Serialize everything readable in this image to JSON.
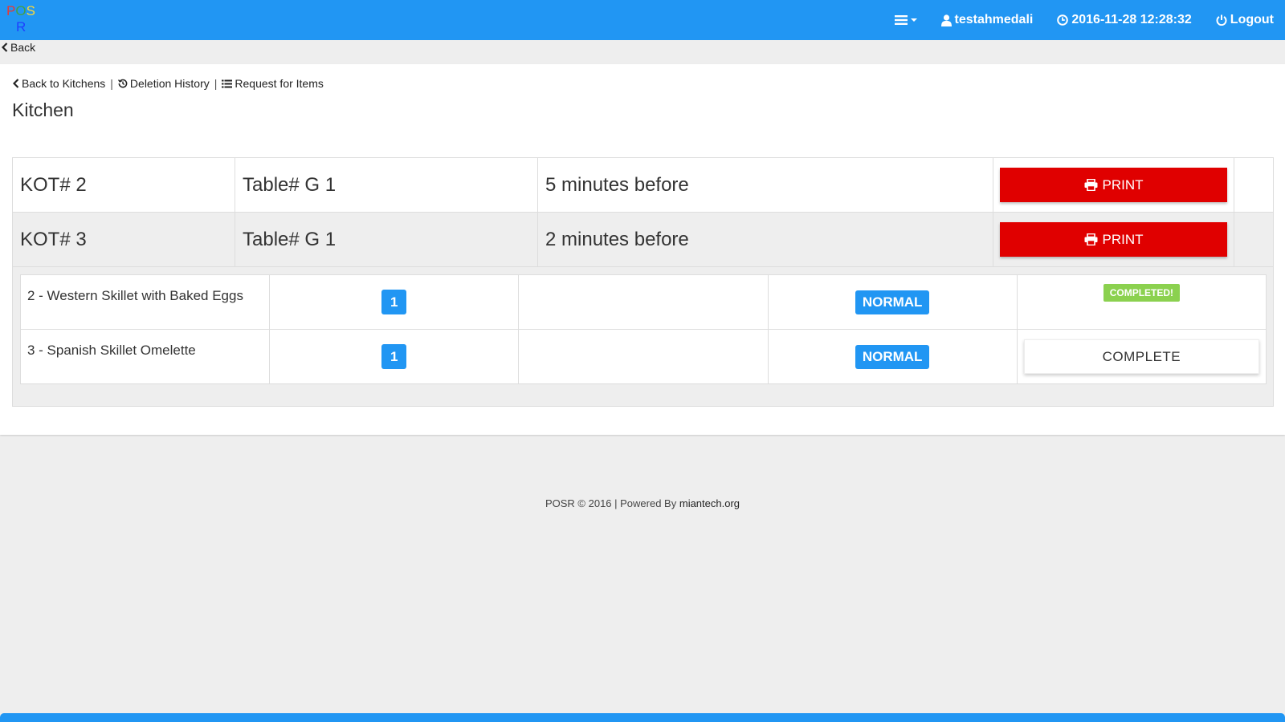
{
  "logo": {
    "letters_top": [
      "P",
      "O",
      "S"
    ],
    "letter_bottom": "R",
    "colors": {
      "P": "#e53935",
      "O": "#43a047",
      "S": "#fdd835",
      "R": "#1e40ff"
    }
  },
  "navbar": {
    "menu_icon": "bars-icon",
    "user": "testahmedali",
    "datetime": "2016-11-28 12:28:32",
    "logout": "Logout",
    "bg_color": "#2196f3"
  },
  "back": {
    "label": "Back"
  },
  "breadcrumb": {
    "back_to_kitchens": "Back to Kitchens",
    "separator": "|",
    "deletion_history": "Deletion History",
    "request_items": "Request for Items"
  },
  "page": {
    "title": "Kitchen"
  },
  "kots": [
    {
      "kot": "KOT# 2",
      "table": "Table# G 1",
      "time": "5 minutes before",
      "print_label": "PRINT"
    },
    {
      "kot": "KOT# 3",
      "table": "Table# G 1",
      "time": "2 minutes before",
      "print_label": "PRINT"
    }
  ],
  "items": [
    {
      "name": "2 - Western Skillet with Baked Eggs",
      "qty": "1",
      "note": "",
      "type": "NORMAL",
      "status": "COMPLETED!"
    },
    {
      "name": "3 - Spanish Skillet Omelette",
      "qty": "1",
      "note": "",
      "type": "NORMAL",
      "action": "COMPLETE"
    }
  ],
  "footer": {
    "text": "POSR © 2016 | Powered By",
    "link": "miantech.org"
  }
}
